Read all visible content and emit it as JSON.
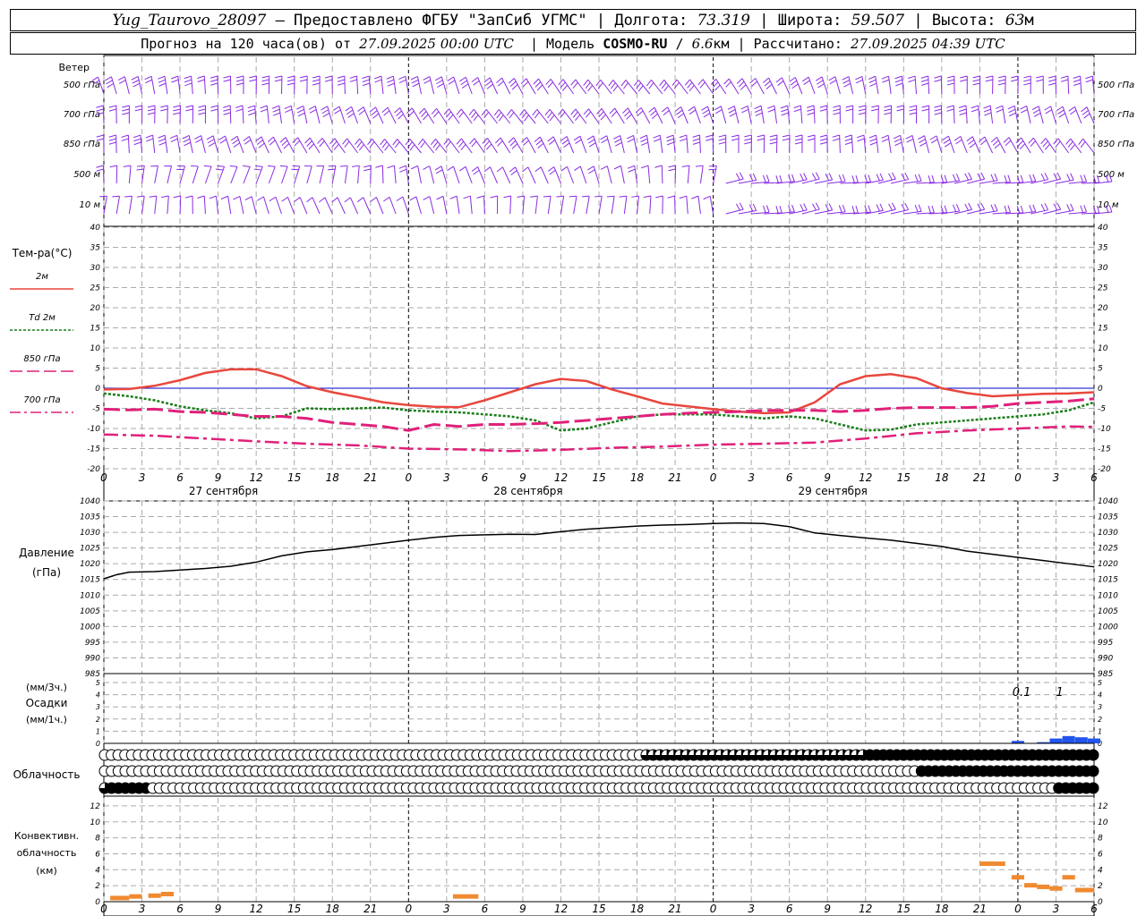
{
  "header": {
    "station": "Yug_Taurovo_28097",
    "provided": "– Предоставлено ФГБУ \"ЗапСиб УГМС\"",
    "lon_label": "Долгота:",
    "lon": "73.319",
    "lat_label": "Широта:",
    "lat": "59.507",
    "alt_label": "Высота:",
    "alt": "63",
    "alt_unit": "м",
    "sep": "|",
    "forecast_prefix": "Прогноз на 120 часа(ов) от",
    "forecast_time": "27.09.2025 00:00 UTC",
    "model_label": "|  Модель",
    "model": "COSMO-RU",
    "model_res_sep": "/",
    "model_res": "6.6",
    "model_res_unit": "км",
    "calc_label": "| Рассчитано:",
    "calc_time": "27.09.2025 04:39 UTC"
  },
  "colors": {
    "t2m": "#e8473d",
    "td2m": "#1a7d1a",
    "t850": "#e0207a",
    "t700": "#e0207a",
    "t500": "#e0207a",
    "wind": "#8a2be2",
    "precip": "#2255ee",
    "conv": "#f08a30",
    "pressure": "#000000",
    "zero": "#0000cc"
  },
  "chart_data": [
    {
      "type": "wind-barbs",
      "label": "Ветер",
      "levels": [
        "500 гПа",
        "700 гПа",
        "850 гПа",
        "500 м",
        "10 м"
      ]
    },
    {
      "type": "line",
      "label": "Тем-ра(°С)",
      "xlim": [
        0,
        78
      ],
      "x_ticks": [
        "0",
        "3",
        "6",
        "9",
        "12",
        "15",
        "18",
        "21",
        "0",
        "3",
        "6",
        "9",
        "12",
        "15",
        "18",
        "21",
        "0",
        "3",
        "6",
        "9",
        "12",
        "15",
        "18",
        "21",
        "0",
        "3",
        "6"
      ],
      "date_labels": [
        "27 сентября",
        "28 сентября",
        "29 сентября"
      ],
      "ylim": [
        -20,
        40
      ],
      "y_ticks": [
        40,
        35,
        30,
        25,
        20,
        15,
        10,
        5,
        0,
        -5,
        -10,
        -15,
        -20
      ],
      "series": [
        {
          "name": "2м",
          "style": "solid",
          "x": [
            0,
            2,
            4,
            6,
            8,
            10,
            12,
            14,
            16,
            18,
            20,
            22,
            24,
            26,
            28,
            30,
            32,
            34,
            36,
            38,
            40,
            42,
            44,
            46,
            48,
            50,
            52,
            54,
            56,
            58,
            60,
            62,
            64,
            66,
            68,
            70,
            72,
            74,
            76,
            78
          ],
          "y": [
            -0.3,
            -0.2,
            0.6,
            2.0,
            3.8,
            4.7,
            4.7,
            3.0,
            0.5,
            -1.0,
            -2.2,
            -3.5,
            -4.2,
            -4.6,
            -4.7,
            -3.0,
            -1.0,
            1.0,
            2.3,
            1.8,
            -0.3,
            -2.0,
            -3.8,
            -4.5,
            -5.2,
            -5.8,
            -6.2,
            -6.0,
            -3.5,
            1.0,
            3.0,
            3.5,
            2.5,
            0.0,
            -1.2,
            -2.0,
            -1.7,
            -1.4,
            -1.3,
            -1.0
          ]
        },
        {
          "name": "Td 2м",
          "style": "dotted",
          "x": [
            0,
            2,
            4,
            6,
            8,
            10,
            12,
            14,
            16,
            18,
            20,
            22,
            24,
            26,
            28,
            30,
            32,
            34,
            36,
            38,
            40,
            42,
            44,
            46,
            48,
            50,
            52,
            54,
            56,
            58,
            60,
            62,
            64,
            66,
            68,
            70,
            72,
            74,
            76,
            78
          ],
          "y": [
            -1.3,
            -2.0,
            -3.0,
            -4.5,
            -5.5,
            -6.2,
            -7.5,
            -7.0,
            -5.0,
            -5.2,
            -5.0,
            -4.8,
            -5.5,
            -5.8,
            -6.0,
            -6.5,
            -7.0,
            -8.0,
            -10.5,
            -10.0,
            -8.5,
            -7.0,
            -6.5,
            -6.5,
            -6.5,
            -7.0,
            -7.5,
            -7.0,
            -7.5,
            -9.0,
            -10.5,
            -10.3,
            -9.0,
            -8.5,
            -8.0,
            -7.5,
            -7.0,
            -6.5,
            -5.5,
            -3.5
          ]
        },
        {
          "name": "850 гПа",
          "style": "long-dash",
          "x": [
            0,
            2,
            4,
            6,
            8,
            10,
            12,
            14,
            16,
            18,
            20,
            22,
            24,
            26,
            28,
            30,
            32,
            34,
            36,
            38,
            40,
            42,
            44,
            46,
            48,
            50,
            52,
            54,
            56,
            58,
            60,
            62,
            64,
            66,
            68,
            70,
            72,
            74,
            76,
            78
          ],
          "y": [
            -5.2,
            -5.4,
            -5.2,
            -5.8,
            -6.0,
            -6.5,
            -7.0,
            -7.0,
            -7.5,
            -8.5,
            -9.0,
            -9.5,
            -10.5,
            -9.0,
            -9.5,
            -9.0,
            -9.0,
            -8.8,
            -8.5,
            -8.0,
            -7.5,
            -7.0,
            -6.5,
            -6.2,
            -6.0,
            -5.8,
            -5.5,
            -5.5,
            -5.5,
            -5.8,
            -5.5,
            -5.0,
            -4.8,
            -4.8,
            -4.8,
            -4.5,
            -3.8,
            -3.5,
            -3.2,
            -2.6
          ]
        },
        {
          "name": "700 гПа",
          "style": "dash-dot",
          "x": [
            0,
            4,
            8,
            12,
            16,
            20,
            24,
            28,
            32,
            36,
            40,
            44,
            48,
            52,
            56,
            60,
            64,
            68,
            72,
            76,
            78
          ],
          "y": [
            -11.5,
            -11.8,
            -12.5,
            -13.2,
            -13.8,
            -14.2,
            -15.0,
            -15.2,
            -15.6,
            -15.3,
            -14.8,
            -14.5,
            -14.0,
            -13.8,
            -13.5,
            -12.5,
            -11.2,
            -10.5,
            -10.0,
            -9.5,
            -9.6
          ]
        }
      ]
    },
    {
      "type": "line",
      "label": "Давление",
      "unit": "(гПа)",
      "xlim": [
        0,
        78
      ],
      "ylim": [
        985,
        1040
      ],
      "y_ticks": [
        1040,
        1035,
        1030,
        1025,
        1020,
        1015,
        1010,
        1005,
        1000,
        995,
        990,
        985
      ],
      "x": [
        0,
        1,
        2,
        4,
        6,
        8,
        10,
        12,
        14,
        16,
        18,
        20,
        22,
        24,
        26,
        28,
        30,
        32,
        34,
        36,
        38,
        40,
        42,
        44,
        46,
        48,
        50,
        52,
        54,
        56,
        58,
        60,
        62,
        64,
        66,
        68,
        70,
        72,
        74,
        76,
        78
      ],
      "y": [
        1015.2,
        1016.5,
        1017.3,
        1017.5,
        1018.0,
        1018.5,
        1019.2,
        1020.5,
        1022.5,
        1023.8,
        1024.5,
        1025.5,
        1026.5,
        1027.5,
        1028.4,
        1029.0,
        1029.2,
        1029.4,
        1029.3,
        1030.2,
        1031.0,
        1031.5,
        1032.0,
        1032.3,
        1032.5,
        1032.8,
        1033.0,
        1032.8,
        1031.8,
        1029.8,
        1029.0,
        1028.2,
        1027.5,
        1026.5,
        1025.5,
        1024.0,
        1023.0,
        1022.0,
        1021.0,
        1020.0,
        1019.0
      ]
    },
    {
      "type": "bar",
      "label": "Осадки",
      "unit_top": "(мм/3ч.)",
      "unit_bottom": "(мм/1ч.)",
      "ylim": [
        0,
        5
      ],
      "y_ticks": [
        5,
        4,
        3,
        2,
        1,
        0
      ],
      "x": [
        72,
        74,
        75,
        76,
        77,
        78
      ],
      "values": [
        0.2,
        0.1,
        0.4,
        0.6,
        0.5,
        0.4
      ],
      "annotations": [
        {
          "x": 73,
          "text": "0.1"
        },
        {
          "x": 76,
          "text": "1"
        }
      ]
    },
    {
      "type": "cloud-symbols",
      "label": "Облачность",
      "rows": [
        {
          "level": "upper",
          "values": "000000000000000000000000000000000000000000000000000000000000000000000000000000001111111111111111111111111111111112222222222222222222222222222222222"
        },
        {
          "level": "middle",
          "values": "0000000000000000000000000000000000000000000000000000000000000000000000000000000000000000000000000000000000000000000000022222222222222222222222222"
        },
        {
          "level": "lower",
          "values": "1222222000000000000000000000000000000000000000000000000000000000000000000000000000000000000000000000000000000000000000000000000000000000000222222"
        }
      ]
    },
    {
      "type": "bar",
      "label": "Конвективн. облачность",
      "unit": "(км)",
      "ylim": [
        0,
        13
      ],
      "y_ticks": [
        12,
        10,
        8,
        6,
        4,
        2,
        0
      ],
      "segments": [
        {
          "x0": 0.5,
          "x1": 2.0,
          "y": 0.4
        },
        {
          "x0": 2.0,
          "x1": 3.0,
          "y": 0.6
        },
        {
          "x0": 3.5,
          "x1": 4.5,
          "y": 0.7
        },
        {
          "x0": 4.5,
          "x1": 5.5,
          "y": 0.9
        },
        {
          "x0": 27.5,
          "x1": 29.5,
          "y": 0.6
        },
        {
          "x0": 69.0,
          "x1": 70.0,
          "y": 4.7
        },
        {
          "x0": 70.0,
          "x1": 71.0,
          "y": 4.7
        },
        {
          "x0": 71.5,
          "x1": 72.5,
          "y": 3.0
        },
        {
          "x0": 72.5,
          "x1": 73.5,
          "y": 2.0
        },
        {
          "x0": 73.5,
          "x1": 74.5,
          "y": 1.8
        },
        {
          "x0": 74.5,
          "x1": 75.5,
          "y": 1.6
        },
        {
          "x0": 75.5,
          "x1": 76.5,
          "y": 3.0
        },
        {
          "x0": 76.5,
          "x1": 78.0,
          "y": 1.4
        }
      ]
    }
  ]
}
